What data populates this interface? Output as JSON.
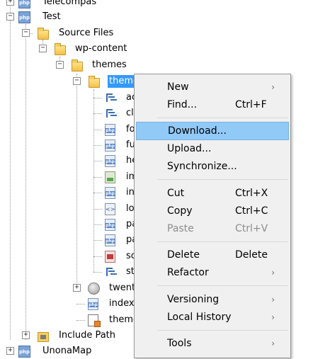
{
  "tree": {
    "nodes": [
      {
        "label": "Telecompas"
      },
      {
        "label": "Test"
      },
      {
        "label": "Source Files"
      },
      {
        "label": "wp-content"
      },
      {
        "label": "themes"
      },
      {
        "label": "theme"
      },
      {
        "label": "ac"
      },
      {
        "label": "cl"
      },
      {
        "label": "fo"
      },
      {
        "label": "fu"
      },
      {
        "label": "he"
      },
      {
        "label": "im"
      },
      {
        "label": "in"
      },
      {
        "label": "lo"
      },
      {
        "label": "pa"
      },
      {
        "label": "pa"
      },
      {
        "label": "sc"
      },
      {
        "label": "st"
      },
      {
        "label": "twenty"
      },
      {
        "label": "index."
      },
      {
        "label": "theme"
      },
      {
        "label": "Include Path"
      },
      {
        "label": "UnonaMap"
      }
    ],
    "php_badge": "php"
  },
  "context_menu": {
    "items": [
      {
        "label": "New",
        "shortcut": "",
        "submenu": "›"
      },
      {
        "label": "Find...",
        "shortcut": "Ctrl+F",
        "submenu": ""
      },
      {
        "label": "Download...",
        "shortcut": "",
        "submenu": ""
      },
      {
        "label": "Upload...",
        "shortcut": "",
        "submenu": ""
      },
      {
        "label": "Synchronize...",
        "shortcut": "",
        "submenu": ""
      },
      {
        "label": "Cut",
        "shortcut": "Ctrl+X",
        "submenu": ""
      },
      {
        "label": "Copy",
        "shortcut": "Ctrl+C",
        "submenu": ""
      },
      {
        "label": "Paste",
        "shortcut": "Ctrl+V",
        "submenu": ""
      },
      {
        "label": "Delete",
        "shortcut": "Delete",
        "submenu": ""
      },
      {
        "label": "Refactor",
        "shortcut": "",
        "submenu": "›"
      },
      {
        "label": "Versioning",
        "shortcut": "",
        "submenu": "›"
      },
      {
        "label": "Local History",
        "shortcut": "",
        "submenu": "›"
      },
      {
        "label": "Tools",
        "shortcut": "",
        "submenu": "›"
      }
    ]
  },
  "colors": {
    "selection": "#3399ff",
    "menu_hover": "#91c9f7",
    "menu_bg": "#f0f0f0"
  }
}
